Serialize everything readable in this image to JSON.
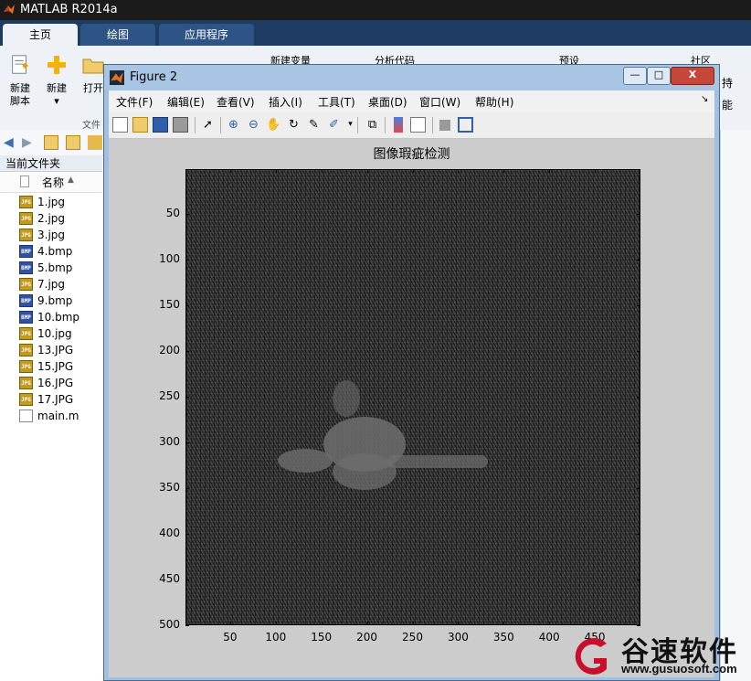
{
  "app": {
    "title": "MATLAB R2014a",
    "icon": "matlab-logo-icon"
  },
  "ribbon": {
    "tabs": [
      {
        "label": "主页",
        "active": true
      },
      {
        "label": "绘图",
        "active": false
      },
      {
        "label": "应用程序",
        "active": false
      }
    ],
    "buttons": {
      "new_script_line1": "新建",
      "new_script_line2": "脚本",
      "new_label": "新建",
      "open_label": "打开",
      "new_variable": "新建变量",
      "analyze_code": "分析代码",
      "preferences": "预设",
      "community": "社区"
    },
    "partial_right_1": "持",
    "partial_right_2": "能",
    "file_group_label": "文件"
  },
  "current_folder": {
    "header": "当前文件夹",
    "column_name": "名称",
    "files": [
      {
        "name": "1.jpg",
        "type": "jpg"
      },
      {
        "name": "2.jpg",
        "type": "jpg"
      },
      {
        "name": "3.jpg",
        "type": "jpg"
      },
      {
        "name": "4.bmp",
        "type": "bmp"
      },
      {
        "name": "5.bmp",
        "type": "bmp"
      },
      {
        "name": "7.jpg",
        "type": "jpg"
      },
      {
        "name": "9.bmp",
        "type": "bmp"
      },
      {
        "name": "10.bmp",
        "type": "bmp"
      },
      {
        "name": "10.jpg",
        "type": "jpg"
      },
      {
        "name": "13.JPG",
        "type": "jpg"
      },
      {
        "name": "15.JPG",
        "type": "jpg"
      },
      {
        "name": "16.JPG",
        "type": "jpg"
      },
      {
        "name": "17.JPG",
        "type": "jpg"
      },
      {
        "name": "main.m",
        "type": "m"
      }
    ],
    "icon_texts": {
      "jpg": "JPG",
      "bmp": "BMP",
      "m": ""
    }
  },
  "figure": {
    "title": "Figure 2",
    "window_buttons": {
      "minimize": "—",
      "maximize": "□",
      "close": "X"
    },
    "menu": [
      "文件(F)",
      "编辑(E)",
      "查看(V)",
      "插入(I)",
      "工具(T)",
      "桌面(D)",
      "窗口(W)",
      "帮助(H)"
    ],
    "menu_overflow": "↘",
    "toolbar_icons": [
      "new-figure-icon",
      "open-file-icon",
      "save-icon",
      "print-icon",
      "pointer-icon",
      "zoom-in-icon",
      "zoom-out-icon",
      "pan-hand-icon",
      "rotate-3d-icon",
      "data-cursor-icon",
      "brush-icon",
      "link-plot-icon",
      "colorbar-icon",
      "legend-icon",
      "hide-plot-tools-icon",
      "show-plot-tools-icon"
    ],
    "plot_title": "图像瑕疵检测"
  },
  "chart_data": {
    "type": "heatmap",
    "title": "图像瑕疵检测",
    "xlabel": "",
    "ylabel": "",
    "x_ticks": [
      50,
      100,
      150,
      200,
      250,
      300,
      350,
      400,
      450
    ],
    "y_ticks": [
      50,
      100,
      150,
      200,
      250,
      300,
      350,
      400,
      450,
      500
    ],
    "xlim": [
      1,
      500
    ],
    "ylim": [
      1,
      500
    ],
    "y_reversed": true,
    "colormap": "gray",
    "grid": false
  },
  "watermark": {
    "name": "谷速软件",
    "url": "www.gusuosoft.com",
    "logo_color": "#c8102e"
  },
  "colors": {
    "ribbon_dark": "#1e3c63",
    "figure_frame": "#9fc0e0",
    "axes_background": "#3c3c3c",
    "close_button": "#c7463a"
  }
}
